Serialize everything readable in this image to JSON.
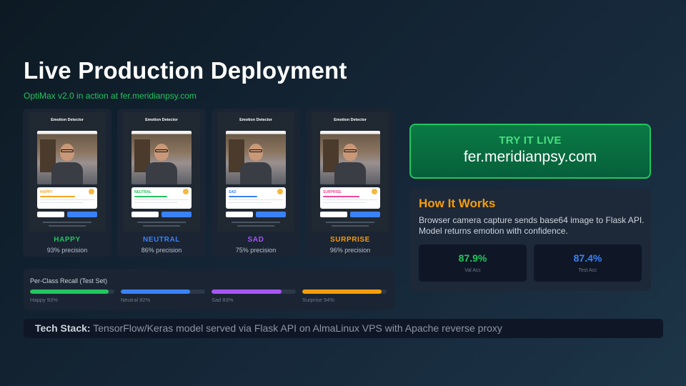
{
  "header": {
    "title": "Live Production Deployment",
    "subtitle": "OptiMax v2.0 in action at fer.meridianpsy.com"
  },
  "screenshots": [
    {
      "app_title": "Emotion Detector",
      "card_label": "HAPPY",
      "label": "HAPPY",
      "precision": "93% precision",
      "color": "#22c55e",
      "bar_color": "#f5a623",
      "bar_fraction": 0.93
    },
    {
      "app_title": "Emotion Detector",
      "card_label": "NEUTRAL",
      "label": "NEUTRAL",
      "precision": "86% precision",
      "color": "#3b82f6",
      "bar_color": "#22c55e",
      "bar_fraction": 0.86
    },
    {
      "app_title": "Emotion Detector",
      "card_label": "SAD",
      "label": "SAD",
      "precision": "75% precision",
      "color": "#a855f7",
      "bar_color": "#3b82f6",
      "bar_fraction": 0.75
    },
    {
      "app_title": "Emotion Detector",
      "card_label": "SURPRISE",
      "label": "SURPRISE",
      "precision": "96% precision",
      "color": "#f59e0b",
      "bar_color": "#ec4899",
      "bar_fraction": 0.96
    }
  ],
  "recall": {
    "title": "Per-Class Recall (Test Set)",
    "items": [
      {
        "label": "Happy 93%",
        "value": 0.93,
        "color": "#22c55e"
      },
      {
        "label": "Neutral 82%",
        "value": 0.82,
        "color": "#3b82f6"
      },
      {
        "label": "Sad 83%",
        "value": 0.83,
        "color": "#a855f7"
      },
      {
        "label": "Surprise 94%",
        "value": 0.94,
        "color": "#f59e0b"
      }
    ]
  },
  "live": {
    "cta": "TRY IT LIVE",
    "url": "fer.meridianpsy.com"
  },
  "how_it_works": {
    "title": "How It Works",
    "description": "Browser camera capture sends base64 image to Flask API. Model returns emotion with confidence.",
    "metrics": [
      {
        "value": "87.9%",
        "label": "Val Acc",
        "color": "#22c55e"
      },
      {
        "value": "87.4%",
        "label": "Test Acc",
        "color": "#3b82f6"
      }
    ]
  },
  "tech_stack": {
    "label": "Tech Stack:",
    "text": "TensorFlow/Keras model served via Flask API on AlmaLinux VPS with Apache reverse proxy"
  }
}
